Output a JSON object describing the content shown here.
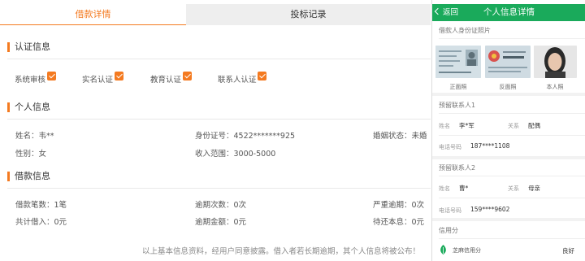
{
  "tabs": [
    {
      "label": "借款详情",
      "active": true
    },
    {
      "label": "投标记录",
      "active": false
    }
  ],
  "accent_color": "#f47a20",
  "certification": {
    "title": "认证信息",
    "items": [
      {
        "label": "系统审核",
        "checked": true
      },
      {
        "label": "实名认证",
        "checked": true
      },
      {
        "label": "教育认证",
        "checked": true
      },
      {
        "label": "联系人认证",
        "checked": true
      }
    ]
  },
  "personal": {
    "title": "个人信息",
    "name": "姓名：韦**",
    "id_number": "身份证号：4522*******925",
    "marital": "婚姻状态：未婚",
    "gender": "性别：女",
    "income": "收入范围：3000-5000"
  },
  "loan": {
    "title": "借款信息",
    "count": "借款笔数：1笔",
    "overdue_times": "逾期次数：0次",
    "severe_overdue": "严重逾期：0次",
    "total_borrowed": "共计借入：0元",
    "overdue_amount": "逾期金额：0元",
    "pending_principal": "待还本息：0元"
  },
  "footnote": "以上基本信息资料，经用户同意披露。借入者若长期逾期，其个人信息将被公布！",
  "mobile": {
    "header_color": "#1aaa5b",
    "back_label": "返回",
    "title": "个人信息详情",
    "id_photos_title": "借款人身份证照片",
    "photo_captions": [
      "正面照",
      "反面照",
      "本人照"
    ],
    "contact1": {
      "title": "预留联系人1",
      "name_label": "姓名",
      "name": "李*军",
      "relation_label": "关系",
      "relation": "配偶",
      "phone_label": "电话号码",
      "phone": "187****1108"
    },
    "contact2": {
      "title": "预留联系人2",
      "name_label": "姓名",
      "name": "曹*",
      "relation_label": "关系",
      "relation": "母亲",
      "phone_label": "电话号码",
      "phone": "159****9602"
    },
    "credit": {
      "title": "信用分",
      "label": "芝麻信用分",
      "value": "良好"
    }
  }
}
